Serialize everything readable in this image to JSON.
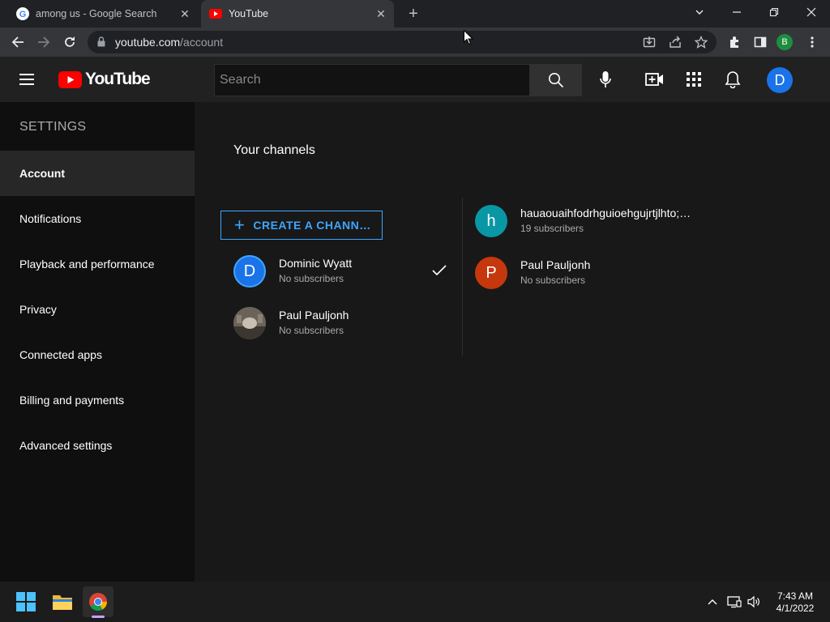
{
  "browser": {
    "tabs": [
      {
        "title": "among us - Google Search",
        "favicon": "google-icon",
        "active": false
      },
      {
        "title": "YouTube",
        "favicon": "youtube-icon",
        "active": true
      }
    ],
    "address": {
      "host": "youtube.com",
      "path": "/account"
    },
    "profile_initial": "B"
  },
  "masthead": {
    "logo_text": "YouTube",
    "search_placeholder": "Search",
    "avatar_initial": "D"
  },
  "sidebar": {
    "title": "SETTINGS",
    "items": [
      {
        "label": "Account",
        "active": true
      },
      {
        "label": "Notifications",
        "active": false
      },
      {
        "label": "Playback and performance",
        "active": false
      },
      {
        "label": "Privacy",
        "active": false
      },
      {
        "label": "Connected apps",
        "active": false
      },
      {
        "label": "Billing and payments",
        "active": false
      },
      {
        "label": "Advanced settings",
        "active": false
      }
    ]
  },
  "main": {
    "title": "Your channels",
    "create_label": "CREATE A CHANN…",
    "channels_left": [
      {
        "initial": "D",
        "name": "Dominic Wyatt",
        "subs": "No subscribers",
        "color": "#1a73e8",
        "selected": true
      },
      {
        "initial": "",
        "name": "Paul Pauljonh",
        "subs": "No subscribers",
        "color": "#8a7f72",
        "photo": true
      }
    ],
    "channels_right": [
      {
        "initial": "h",
        "name": "hauaouaihfodrhguioehgujrtjlhto;…",
        "subs": "19 subscribers",
        "color": "#0a97a5"
      },
      {
        "initial": "P",
        "name": "Paul Pauljonh",
        "subs": "No subscribers",
        "color": "#c5380e"
      }
    ]
  },
  "taskbar": {
    "time": "7:43 AM",
    "date": "4/1/2022"
  }
}
